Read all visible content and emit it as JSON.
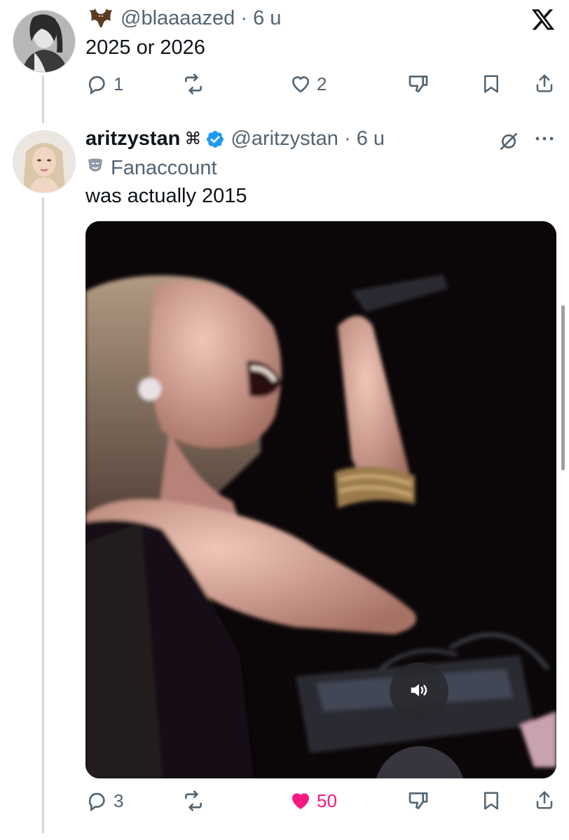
{
  "post1": {
    "handle": "@blaaaazed",
    "time": "6 u",
    "text": "2025 or 2026",
    "reply_count": "1",
    "repost_count": "",
    "like_count": "2"
  },
  "post2": {
    "display_name": "aritzystan",
    "name_symbol": "⌘",
    "handle": "@aritzystan",
    "time": "6 u",
    "label": "Fanaccount",
    "text": "was actually 2015",
    "reply_count": "3",
    "like_count": "50",
    "liked": true
  },
  "icons": {
    "close": "x-logo-icon",
    "grok": "grok-icon",
    "more": "more-icon",
    "sound": "speaker-icon"
  },
  "colors": {
    "text": "#0f1419",
    "secondary": "#536471",
    "verified": "#1d9bf0",
    "like": "#f91880",
    "thread_line": "#cfd9de"
  }
}
